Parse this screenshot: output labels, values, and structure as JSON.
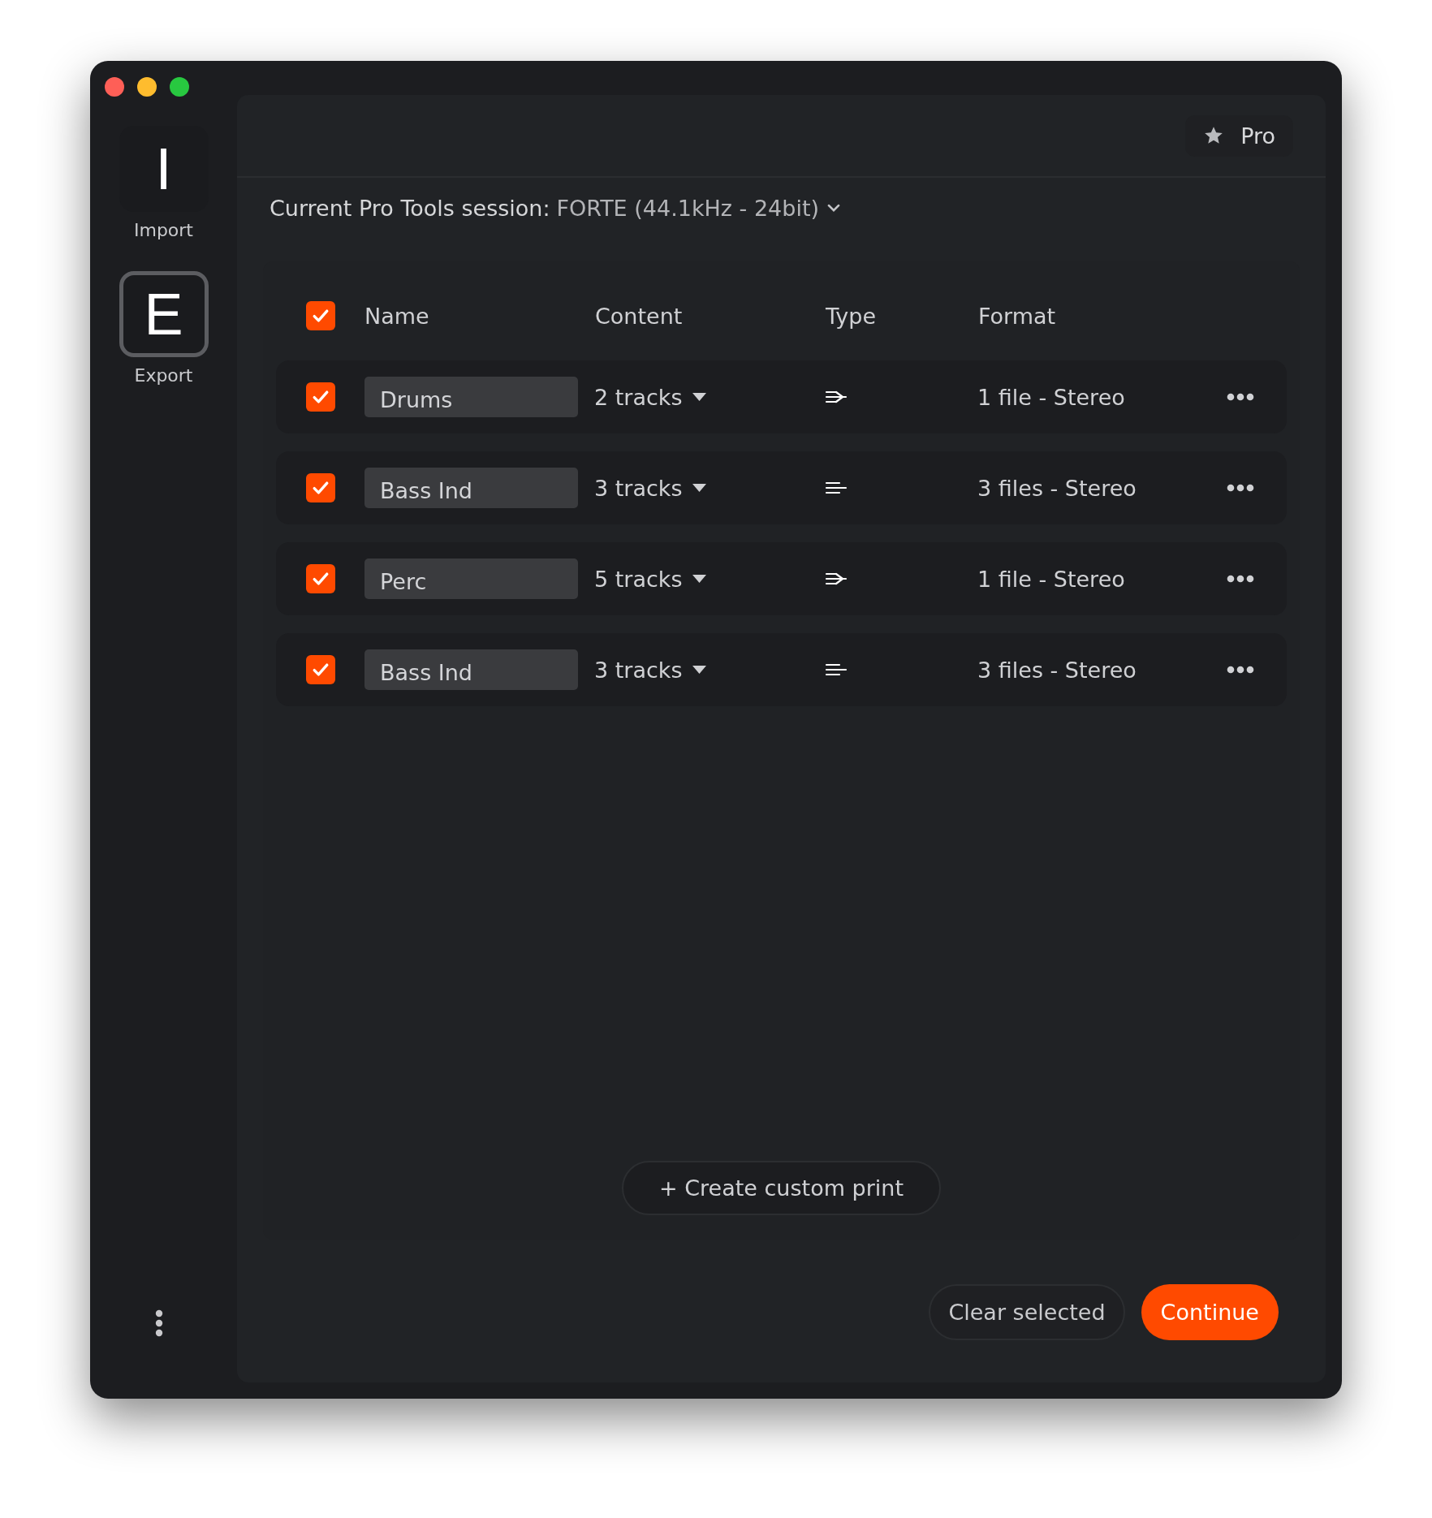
{
  "sidebar": {
    "items": [
      {
        "letter": "I",
        "label": "Import",
        "selected": false
      },
      {
        "letter": "E",
        "label": "Export",
        "selected": true
      }
    ]
  },
  "header": {
    "badge": "Pro"
  },
  "session": {
    "label": "Current Pro Tools session:",
    "value": "FORTE (44.1kHz - 24bit)"
  },
  "table": {
    "select_all": {
      "checked": true
    },
    "columns": [
      "Name",
      "Content",
      "Type",
      "Format"
    ],
    "rows": [
      {
        "checked": true,
        "name": "Drums",
        "content": "2 tracks",
        "kind": "single",
        "format": "1 file - Stereo"
      },
      {
        "checked": true,
        "name": "Bass Ind",
        "content": "3 tracks",
        "kind": "multi",
        "format": "3 files - Stereo"
      },
      {
        "checked": true,
        "name": "Perc",
        "content": "5 tracks",
        "kind": "single",
        "format": "1 file - Stereo"
      },
      {
        "checked": true,
        "name": "Bass Ind",
        "content": "3 tracks",
        "kind": "multi",
        "format": "3 files - Stereo"
      }
    ]
  },
  "create_button": "+ Create custom print",
  "buttons": {
    "clear": "Clear selected",
    "continue": "Continue"
  }
}
